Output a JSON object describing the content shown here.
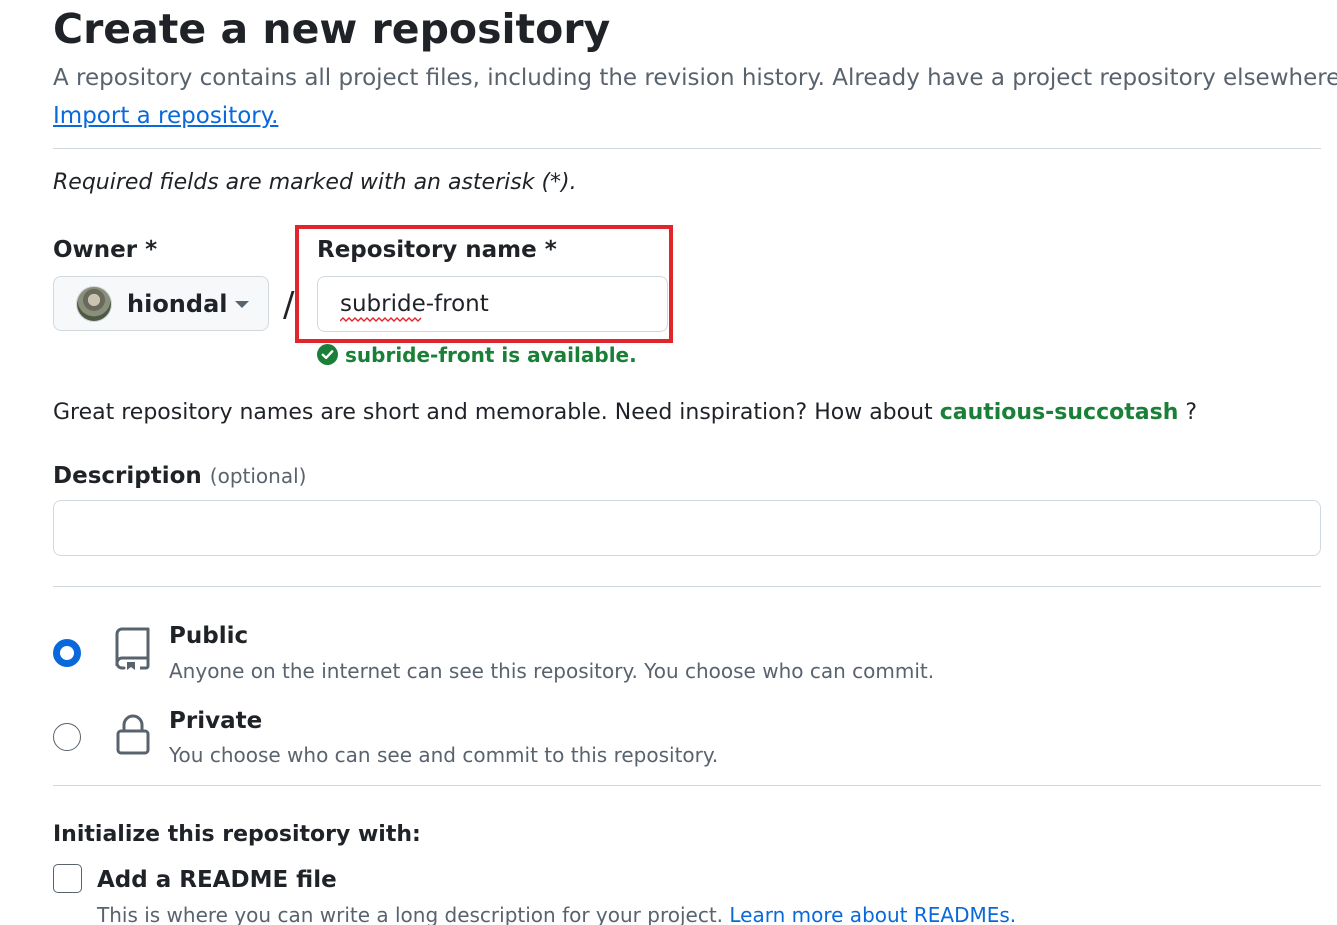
{
  "header": {
    "title": "Create a new repository",
    "subtitle": "A repository contains all project files, including the revision history. Already have a project repository elsewhere?",
    "import_link": "Import a repository."
  },
  "form": {
    "required_note": "Required fields are marked with an asterisk (*).",
    "owner": {
      "label": "Owner *",
      "value": "hiondal",
      "avatar_icon": "user-avatar",
      "dropdown_icon": "caret-down-icon"
    },
    "separator": "/",
    "repo_name": {
      "label": "Repository name *",
      "value": "subride-front",
      "availability_icon": "check-circle-fill-icon",
      "availability": "subride-front is available."
    },
    "suggestion": {
      "prefix": "Great repository names are short and memorable. Need inspiration? How about",
      "name": "cautious-succotash",
      "suffix": "?"
    },
    "description": {
      "label": "Description",
      "optional": "(optional)",
      "value": ""
    },
    "visibility": [
      {
        "title": "Public",
        "description": "Anyone on the internet can see this repository. You choose who can commit.",
        "icon": "repo-icon",
        "selected": true
      },
      {
        "title": "Private",
        "description": "You choose who can see and commit to this repository.",
        "icon": "lock-icon",
        "selected": false
      }
    ],
    "initialize": {
      "heading": "Initialize this repository with:",
      "readme_label": "Add a README file",
      "readme_checked": false,
      "readme_description": "This is where you can write a long description for your project.",
      "readme_link": "Learn more about READMEs."
    }
  },
  "colors": {
    "accent": "#0969da",
    "success": "#1a7f37",
    "highlight": "#e0262c",
    "muted_text": "#59636e",
    "border": "#d1d9e0"
  }
}
